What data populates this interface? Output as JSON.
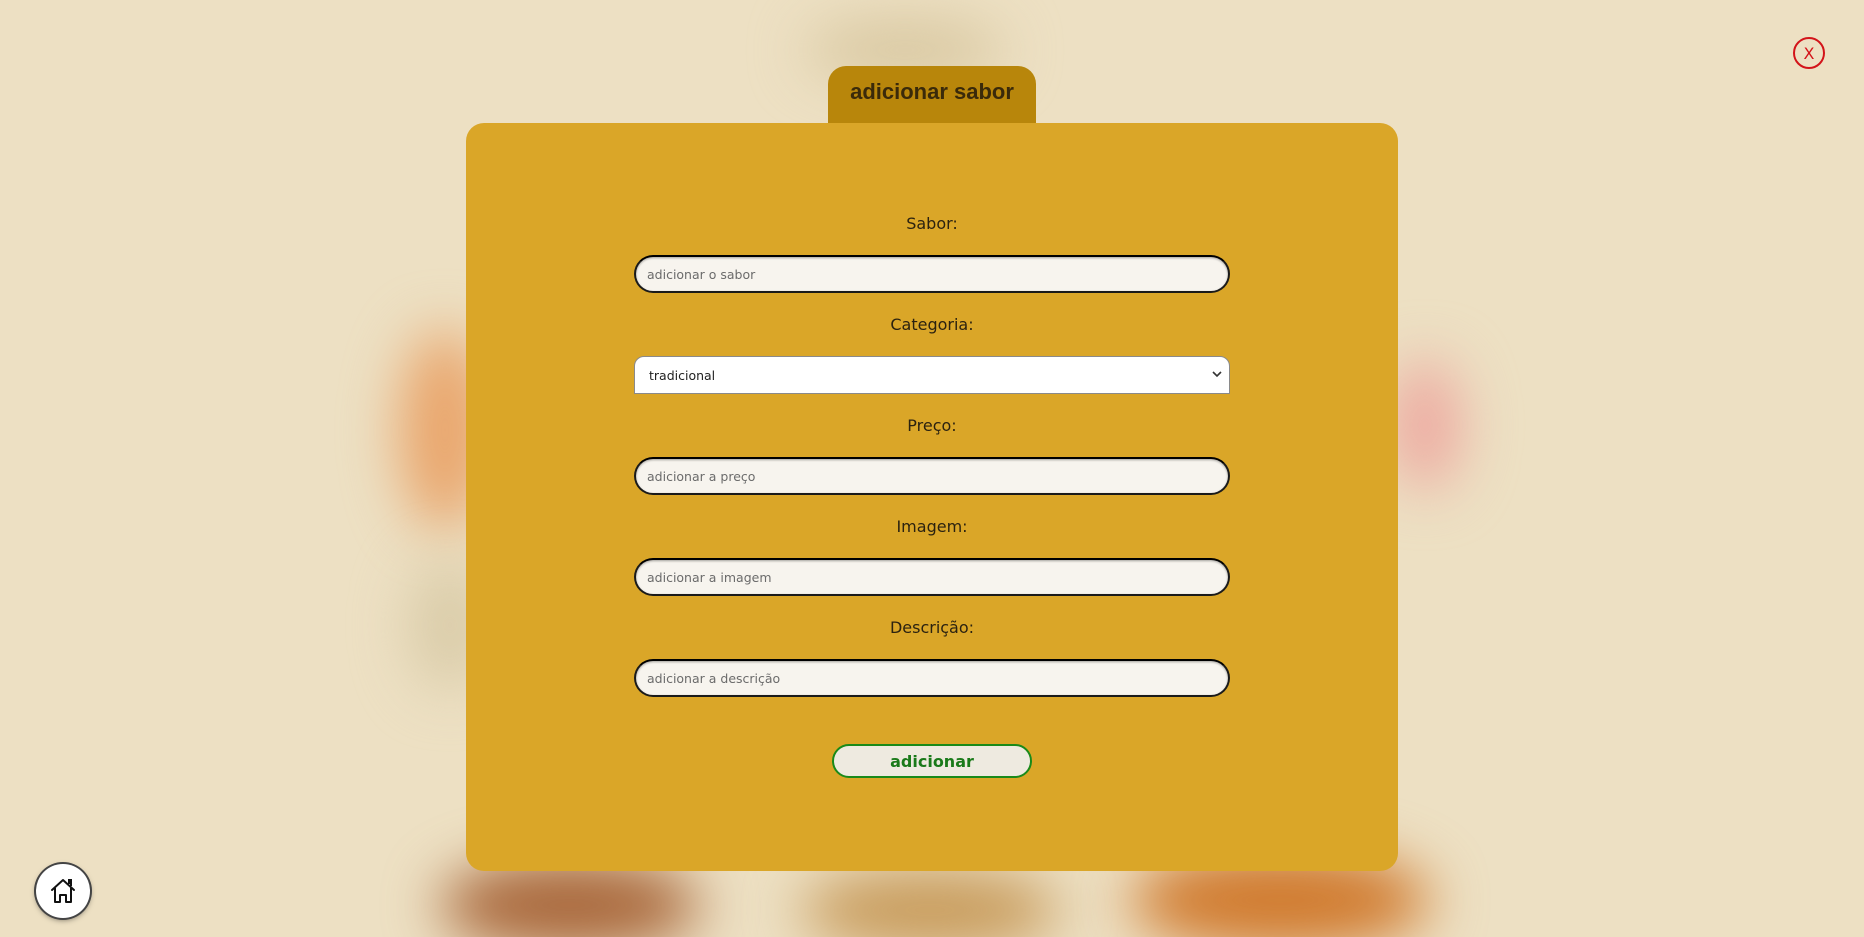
{
  "modal": {
    "title": "adicionar sabor",
    "close_label": "X"
  },
  "form": {
    "flavor": {
      "label": "Sabor:",
      "placeholder": "adicionar o sabor"
    },
    "category": {
      "label": "Categoria:",
      "selected": "tradicional"
    },
    "price": {
      "label": "Preço:",
      "placeholder": "adicionar a preço"
    },
    "image": {
      "label": "Imagem:",
      "placeholder": "adicionar a imagem"
    },
    "description": {
      "label": "Descrição:",
      "placeholder": "adicionar a descrição"
    },
    "submit_label": "adicionar"
  },
  "icons": {
    "home": "home-icon",
    "chevron": "chevron-down-icon"
  },
  "colors": {
    "page_background": "#ede0c3",
    "modal_background": "#daa628",
    "tab_background": "#b8860b",
    "close_accent": "#d3141a",
    "submit_accent": "#1a8a1a"
  }
}
